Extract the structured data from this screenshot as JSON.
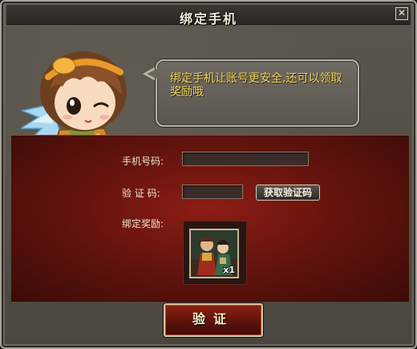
{
  "window": {
    "title": "绑定手机",
    "close_icon": "close-icon"
  },
  "speech_bubble": {
    "text": "绑定手机让账号更安全,还可以领取奖励哦"
  },
  "form": {
    "phone_label": "手机号码:",
    "phone_value": "",
    "code_label": "验 证 码:",
    "code_value": "",
    "get_code_button": "获取验证码",
    "reward_label": "绑定奖励:"
  },
  "reward": {
    "icon": "character-card-icon",
    "count": "x1"
  },
  "verify_button": "验证",
  "colors": {
    "bubble_text": "#f2d35a",
    "panel_red": "#8c1d14",
    "frame": "#5b574f"
  }
}
